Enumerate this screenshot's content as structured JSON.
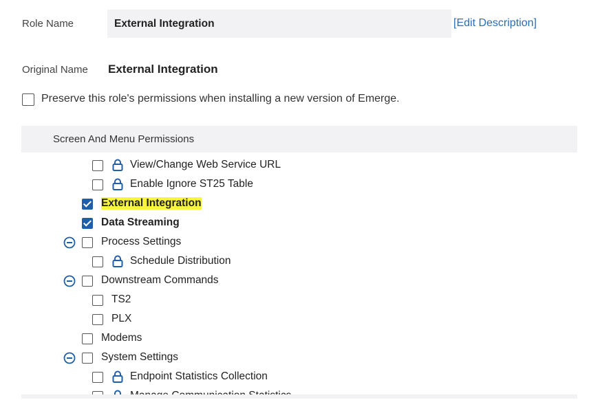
{
  "role": {
    "label": "Role Name",
    "value": "External Integration",
    "edit_link": "[Edit Description]"
  },
  "original": {
    "label": "Original Name",
    "value": "External Integration"
  },
  "preserve": {
    "label": "Preserve this role's permissions when installing a new version of Emerge.",
    "checked": false
  },
  "section": {
    "title": "Screen And Menu Permissions"
  },
  "tree": [
    {
      "label": "View/Change Web Service URL",
      "checked": false,
      "lock": true
    },
    {
      "label": "Enable Ignore ST25 Table",
      "checked": false,
      "lock": true
    },
    {
      "label": "External Integration",
      "checked": true,
      "highlighted": true
    },
    {
      "label": "Data Streaming",
      "checked": true
    },
    {
      "label": "Process Settings",
      "checked": false,
      "collapsible": true
    },
    {
      "label": "Schedule Distribution",
      "checked": false,
      "lock": true
    },
    {
      "label": "Downstream Commands",
      "checked": false,
      "collapsible": true
    },
    {
      "label": "TS2",
      "checked": false
    },
    {
      "label": "PLX",
      "checked": false
    },
    {
      "label": "Modems",
      "checked": false
    },
    {
      "label": "System Settings",
      "checked": false,
      "collapsible": true
    },
    {
      "label": "Endpoint Statistics Collection",
      "checked": false,
      "lock": true
    },
    {
      "label": "Manage Communication Statistics",
      "checked": false,
      "lock": true
    }
  ],
  "colors": {
    "accent": "#1f5fa9",
    "link": "#2a6db5",
    "highlight": "#f7f53d",
    "panel_bg": "#f2f2f4"
  },
  "icons": {
    "lock": "lock-icon",
    "collapse": "collapse-minus-icon"
  }
}
